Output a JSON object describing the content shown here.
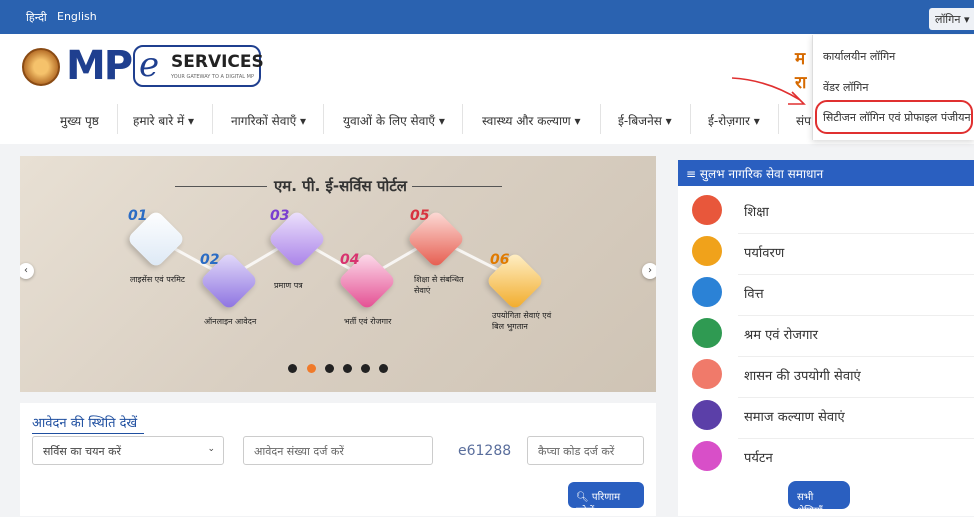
{
  "topbar": {
    "lang_hindi": "हिन्दी",
    "lang_english": "English",
    "login_label": "लॉगिन ▾"
  },
  "brand": {
    "mp": "MP",
    "e": "e",
    "services": "SERVICES",
    "tagline": "YOUR GATEWAY TO A DIGITAL MP",
    "partial_line1": "म",
    "partial_line2": "रा"
  },
  "nav": [
    {
      "label": "मुख्य पृष्ठ"
    },
    {
      "label": "हमारे बारे में ▾"
    },
    {
      "label": "नागरिकों सेवाएँ ▾"
    },
    {
      "label": "युवाओं के लिए सेवाएँ ▾"
    },
    {
      "label": "स्वास्थ्य और कल्याण ▾"
    },
    {
      "label": "ई-बिजनेस ▾"
    },
    {
      "label": "ई-रोज़गार ▾"
    },
    {
      "label": "संप"
    }
  ],
  "login_dropdown": [
    {
      "label": "कार्यालयीन लॉगिन"
    },
    {
      "label": "वेंडर लॉगिन"
    },
    {
      "label": "सिटीजन लॉगिन एवं प्रोफाइल पंजीयन"
    }
  ],
  "carousel": {
    "title": "एम. पी. ई-सर्विस पोर्टल",
    "steps": [
      {
        "num": "01",
        "label": "लाइसेंस एवं परमिट"
      },
      {
        "num": "02",
        "label": "ऑनलाइन आवेदन"
      },
      {
        "num": "03",
        "label": "प्रमाण पत्र"
      },
      {
        "num": "04",
        "label": "भर्ती एवं रोजगार"
      },
      {
        "num": "05",
        "label": "शिक्षा से संबन्धित सेवाएं"
      },
      {
        "num": "06",
        "label": "उपयोगिता सेवाएं एवं बिल भुगतान"
      }
    ],
    "prev": "‹",
    "next": "›",
    "active_slide": 2,
    "slide_count": 6
  },
  "status": {
    "title": "आवेदन की स्थिति देखें",
    "service_select": "सर्विस का चयन करें",
    "application_placeholder": "आवेदन संख्या दर्ज करें",
    "captcha": "e61288",
    "captcha_placeholder": "कैप्चा कोड दर्ज करें",
    "search_button": "परिणाम खोजें"
  },
  "sidebar": {
    "title": "सुलभ नागरिक सेवा समाधान",
    "items": [
      {
        "label": "शिक्षा",
        "color": "#e8573b"
      },
      {
        "label": "पर्यावरण",
        "color": "#f0a21b"
      },
      {
        "label": "वित्त",
        "color": "#2b82d6"
      },
      {
        "label": "श्रम एवं रोजगार",
        "color": "#2f9a52"
      },
      {
        "label": "शासन की उपयोगी सेवाएं",
        "color": "#f07a6a"
      },
      {
        "label": "समाज कल्याण सेवाएं",
        "color": "#5b3fa8"
      },
      {
        "label": "पर्यटन",
        "color": "#d84fc8"
      }
    ],
    "all_categories": "सभी श्रेणियाँ"
  },
  "colors": {
    "primary": "#2a62b0",
    "accent": "#d66a00",
    "highlight": "#e03030"
  }
}
